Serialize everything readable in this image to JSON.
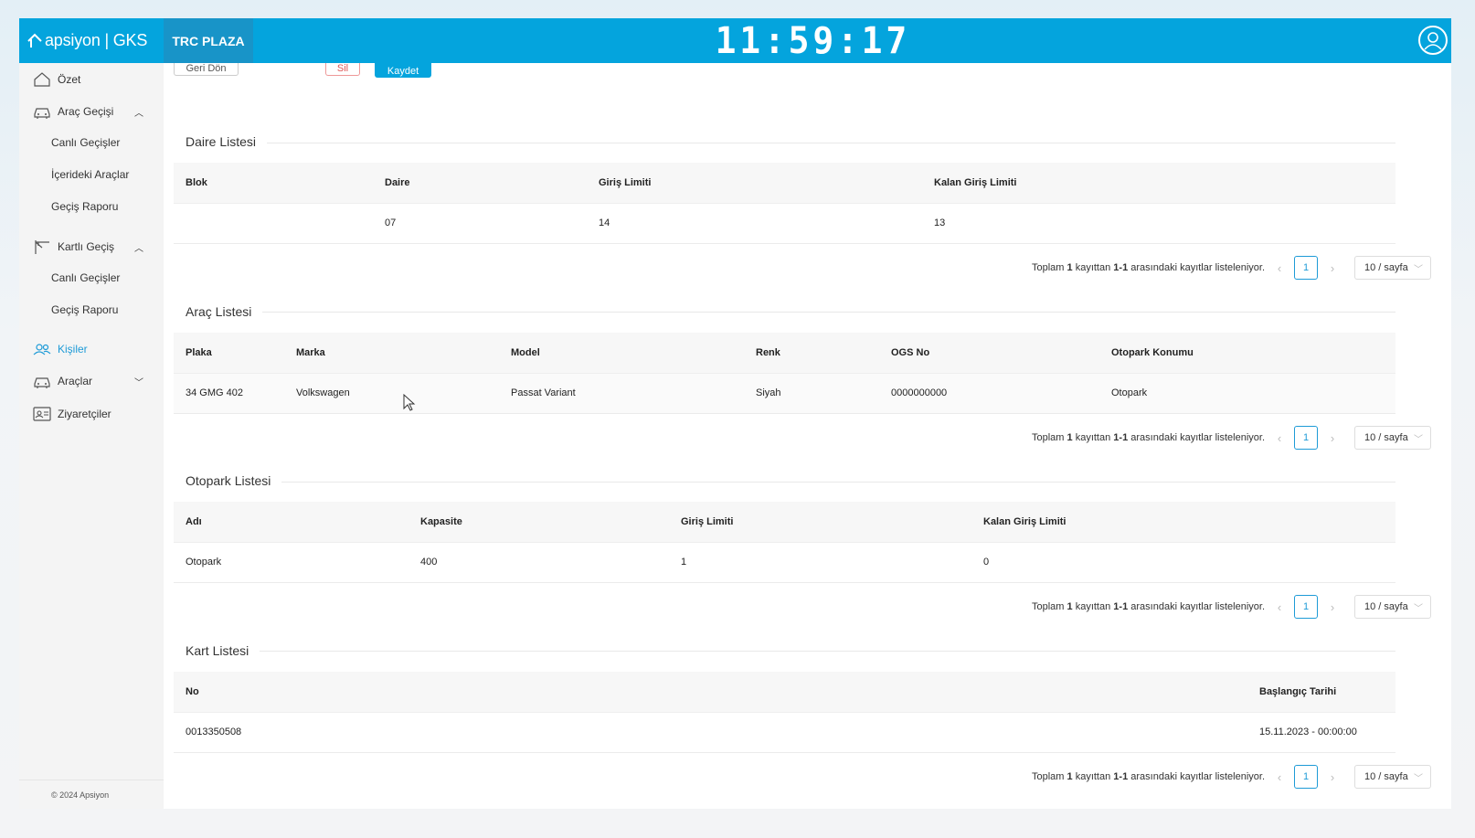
{
  "header": {
    "logo_text": "apsiyon | GKS",
    "project_name": "TRC PLAZA",
    "clock": "11:59:17"
  },
  "sidebar": {
    "items": [
      {
        "label": "Özet",
        "icon": "home-icon"
      },
      {
        "label": "Araç Geçişi",
        "icon": "car-icon",
        "expanded": true
      },
      {
        "label": "Canlı Geçişler"
      },
      {
        "label": "İçerideki Araçlar"
      },
      {
        "label": "Geçiş Raporu"
      },
      {
        "label": "Kartlı Geçiş",
        "icon": "barrier-icon",
        "expanded": true
      },
      {
        "label": "Canlı Geçişler"
      },
      {
        "label": "Geçiş Raporu"
      },
      {
        "label": "Kişiler",
        "icon": "people-icon",
        "active": true
      },
      {
        "label": "Araçlar",
        "icon": "car-icon",
        "expanded": false
      },
      {
        "label": "Ziyaretçiler",
        "icon": "visitor-card-icon"
      }
    ],
    "footer": "© 2024 Apsiyon"
  },
  "toolbar": {
    "back_label": "Geri Dön",
    "delete_label": "Sil",
    "save_label": "Kaydet"
  },
  "pagination": {
    "summary_prefix": "Toplam",
    "summary_total": "1",
    "summary_mid": "kayıttan",
    "summary_range": "1-1",
    "summary_suffix": "arasındaki kayıtlar listeleniyor.",
    "current_page": "1",
    "page_size": "10 / sayfa"
  },
  "daire_listesi": {
    "title": "Daire Listesi",
    "columns": [
      "Blok",
      "Daire",
      "Giriş Limiti",
      "Kalan Giriş Limiti"
    ],
    "rows": [
      [
        "",
        "07",
        "14",
        "13"
      ]
    ]
  },
  "arac_listesi": {
    "title": "Araç Listesi",
    "columns": [
      "Plaka",
      "Marka",
      "Model",
      "Renk",
      "OGS No",
      "Otopark Konumu"
    ],
    "rows": [
      [
        "34 GMG 402",
        "Volkswagen",
        "Passat Variant",
        "Siyah",
        "0000000000",
        "Otopark"
      ]
    ]
  },
  "otopark_listesi": {
    "title": "Otopark Listesi",
    "columns": [
      "Adı",
      "Kapasite",
      "Giriş Limiti",
      "Kalan Giriş Limiti"
    ],
    "rows": [
      [
        "Otopark",
        "400",
        "1",
        "0"
      ]
    ]
  },
  "kart_listesi": {
    "title": "Kart Listesi",
    "columns": [
      "No",
      "Başlangıç Tarihi"
    ],
    "rows": [
      [
        "0013350508",
        "15.11.2023 - 00:00:00"
      ]
    ]
  },
  "colors": {
    "brand": "#04a4dd",
    "brand_dark": "#1894c8",
    "active": "#1e9bd7"
  }
}
